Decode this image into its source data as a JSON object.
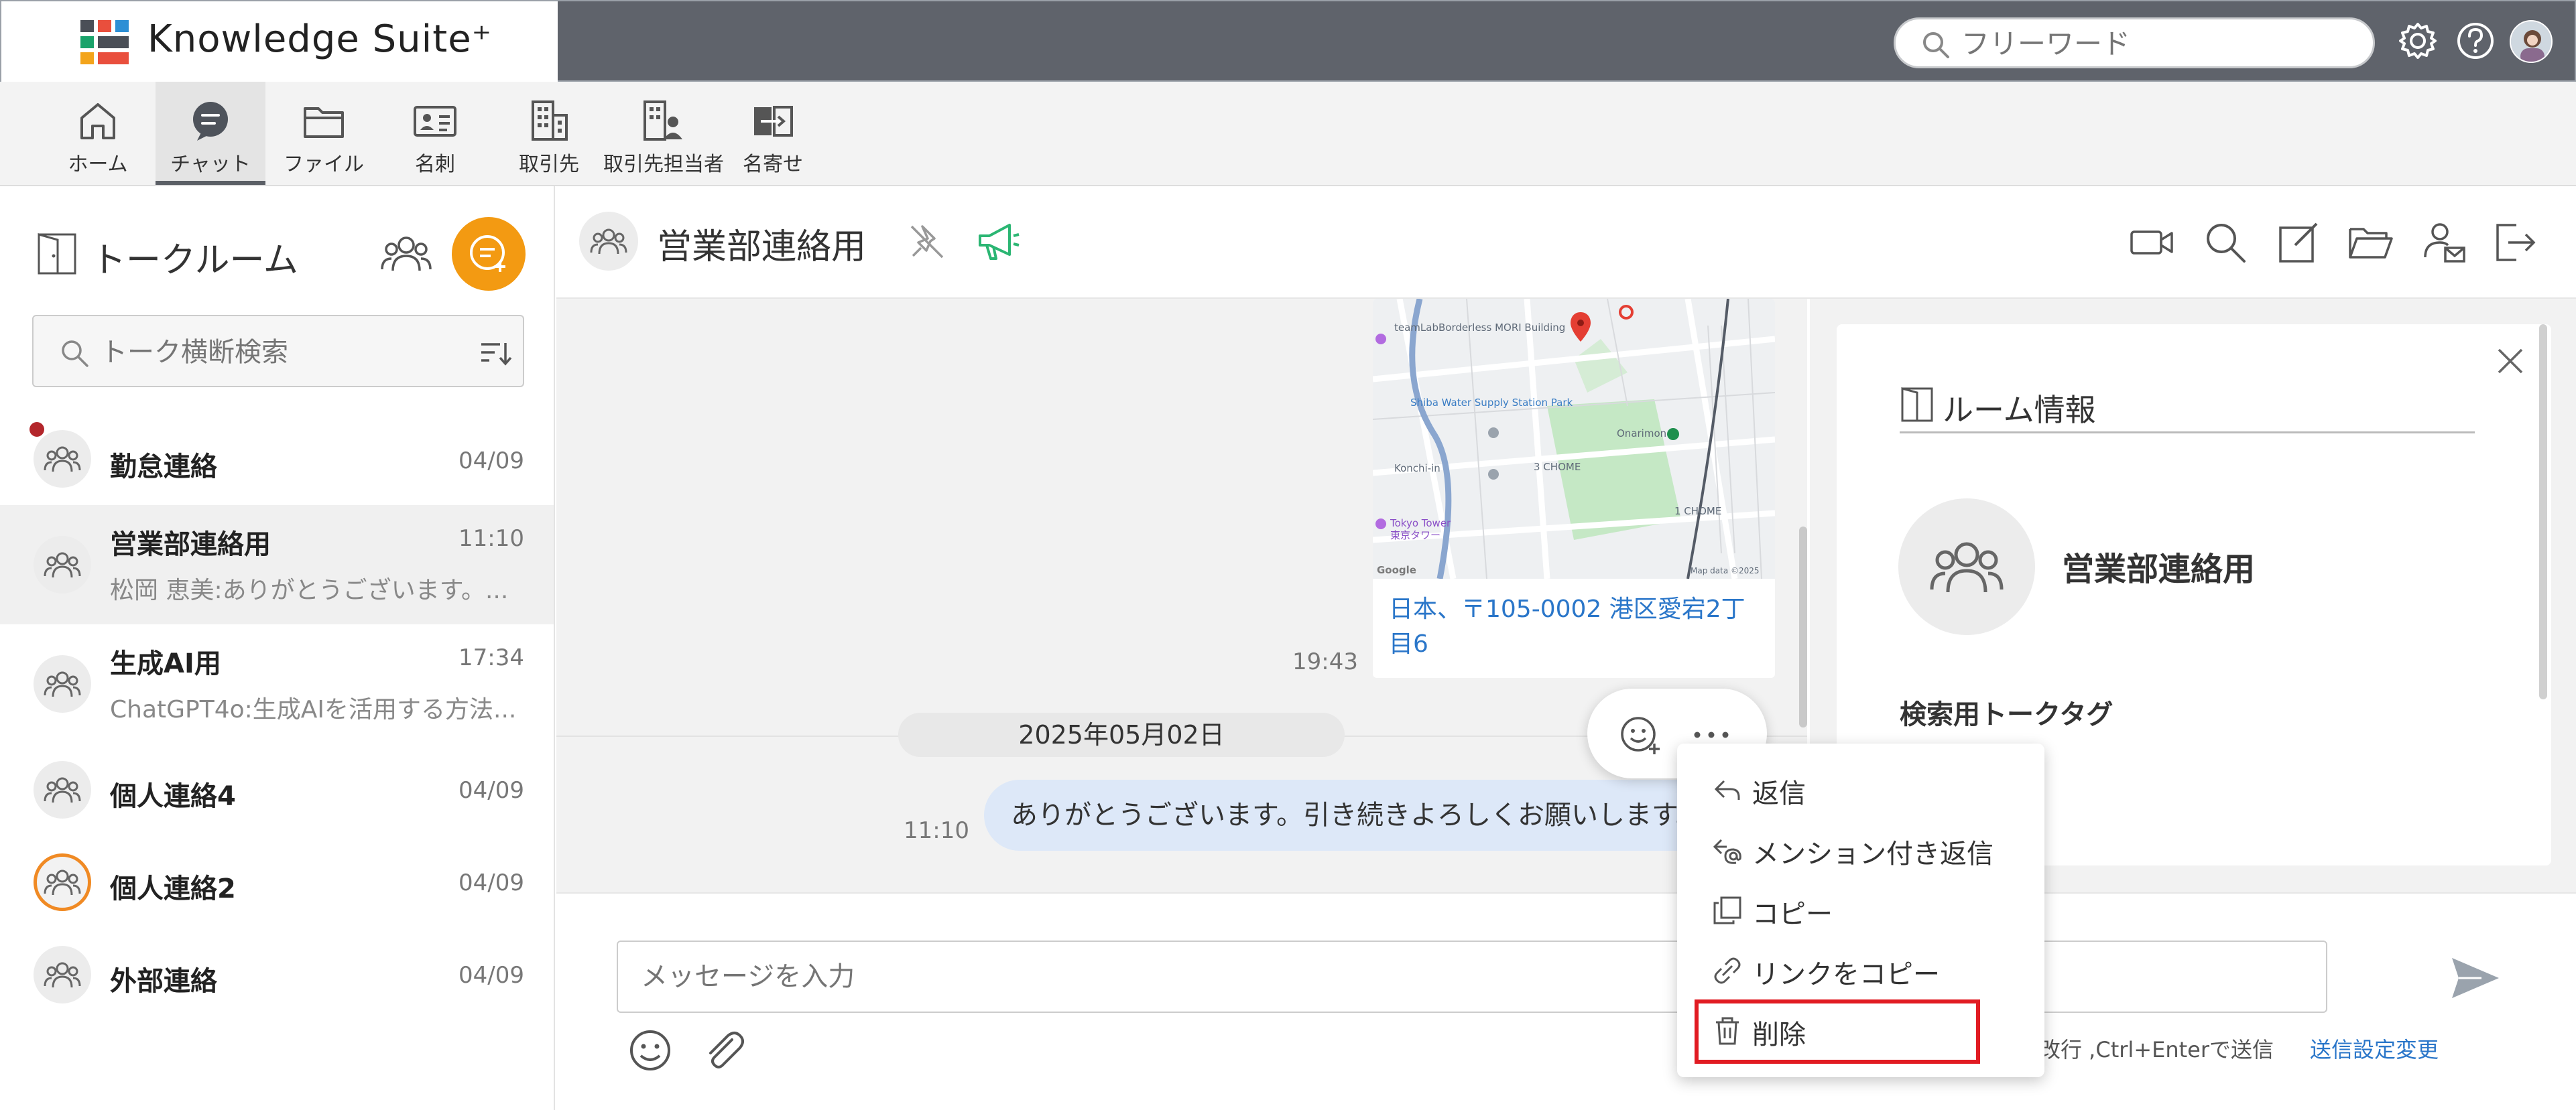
{
  "app": {
    "name": "Knowledge Suite⁺"
  },
  "header": {
    "search_placeholder": "フリーワード",
    "icons": [
      "gear-icon",
      "help-icon",
      "user-avatar"
    ]
  },
  "nav": {
    "items": [
      {
        "label": "ホーム",
        "icon": "home-icon",
        "active": false
      },
      {
        "label": "チャット",
        "icon": "chat-icon",
        "active": true
      },
      {
        "label": "ファイル",
        "icon": "folder-icon",
        "active": false
      },
      {
        "label": "名刺",
        "icon": "business-card-icon",
        "active": false
      },
      {
        "label": "取引先",
        "icon": "building-icon",
        "active": false
      },
      {
        "label": "取引先担当者",
        "icon": "building-person-icon",
        "active": false
      },
      {
        "label": "名寄せ",
        "icon": "merge-icon",
        "active": false
      }
    ]
  },
  "sidebar": {
    "title": "トークルーム",
    "search_placeholder": "トーク横断検索",
    "rooms": [
      {
        "name": "勤怠連絡",
        "time": "04/09",
        "preview": "",
        "unread": true,
        "selected": false
      },
      {
        "name": "営業部連絡用",
        "time": "11:10",
        "preview": "松岡 恵美:ありがとうございます。...",
        "unread": false,
        "selected": true
      },
      {
        "name": "生成AI用",
        "time": "17:34",
        "preview": "ChatGPT4o:生成AIを活用する方法...",
        "unread": false,
        "selected": false
      },
      {
        "name": "個人連絡4",
        "time": "04/09",
        "preview": "",
        "unread": false,
        "selected": false
      },
      {
        "name": "個人連絡2",
        "time": "04/09",
        "preview": "",
        "unread": false,
        "selected": false,
        "ring": true
      },
      {
        "name": "外部連絡",
        "time": "04/09",
        "preview": "",
        "unread": false,
        "selected": false
      }
    ]
  },
  "chat": {
    "title": "営業部連絡用",
    "map": {
      "address": "日本、〒105-0002 港区愛宕2丁目6",
      "time": "19:43",
      "labels": {
        "building": "teamLabBorderless MORI Building",
        "station": "Shiba Water Supply Station Park",
        "onarimon": "Onarimon",
        "chome3": "3 CHOME",
        "chome1": "1 CHOME",
        "konchiin": "Konchi-in",
        "tower": "Tokyo Tower",
        "tower_jp": "東京タワー",
        "google": "Google",
        "mapdata": "Map data ©2025"
      }
    },
    "date_separator": "2025年05月02日",
    "message": {
      "text": "ありがとうございます。引き続きよろしくお願いします。",
      "time": "11:10"
    },
    "input_placeholder": "メッセージを入力",
    "hint": "で改行 ,Ctrl+Enterで送信",
    "send_setting": "送信設定変更"
  },
  "context_menu": {
    "items": [
      {
        "label": "返信",
        "icon": "reply-icon"
      },
      {
        "label": "メンション付き返信",
        "icon": "mention-reply-icon"
      },
      {
        "label": "コピー",
        "icon": "copy-icon"
      },
      {
        "label": "リンクをコピー",
        "icon": "link-icon"
      },
      {
        "label": "削除",
        "icon": "trash-icon"
      }
    ]
  },
  "room_info": {
    "title": "ルーム情報",
    "name": "営業部連絡用",
    "tag_label": "検索用トークタグ"
  },
  "colors": {
    "topbar": "#5f636b",
    "accent_orange": "#f39a12",
    "link_blue": "#2a76c9",
    "highlight_red": "#e11b22",
    "bubble": "#dde8f8"
  }
}
